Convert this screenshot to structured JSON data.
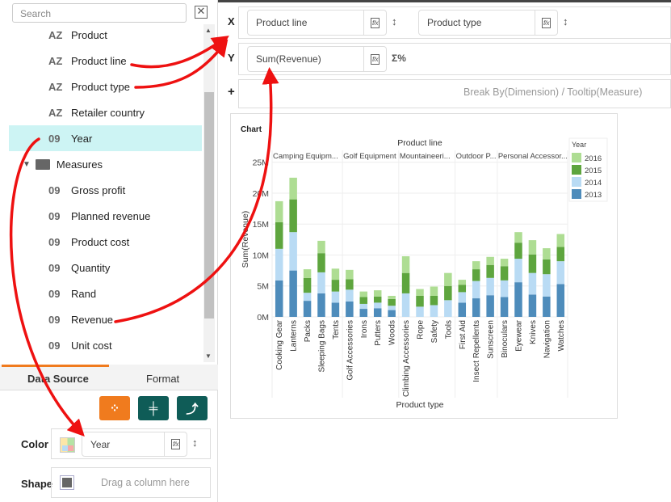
{
  "sidebar": {
    "search_placeholder": "Search",
    "dimensions": [
      {
        "type": "AZ",
        "label": "Product"
      },
      {
        "type": "AZ",
        "label": "Product line"
      },
      {
        "type": "AZ",
        "label": "Product type"
      },
      {
        "type": "AZ",
        "label": "Retailer country"
      },
      {
        "type": "09",
        "label": "Year",
        "selected": true
      }
    ],
    "measures_folder": "Measures",
    "measures": [
      {
        "type": "09",
        "label": "Gross profit"
      },
      {
        "type": "09",
        "label": "Planned revenue"
      },
      {
        "type": "09",
        "label": "Product cost"
      },
      {
        "type": "09",
        "label": "Quantity"
      },
      {
        "type": "09",
        "label": "Rand"
      },
      {
        "type": "09",
        "label": "Revenue"
      },
      {
        "type": "09",
        "label": "Unit cost"
      }
    ],
    "tabs": [
      "Data Source",
      "Format"
    ],
    "color_label": "Color",
    "color_value": "Year",
    "shape_label": "Shape",
    "shape_placeholder": "Drag a column here"
  },
  "shelves": {
    "x_label": "X",
    "x_fields": [
      "Product line",
      "Product type"
    ],
    "y_label": "Y",
    "y_field": "Sum(Revenue)",
    "y_icon": "Σ%",
    "plus_label": "+",
    "break_placeholder": "Break By(Dimension) / Tooltip(Measure)",
    "fx": "f/x"
  },
  "colors": {
    "accent": "#f07b1e",
    "teal": "#0f5c57",
    "arrow": "#ee1111"
  },
  "chart_data": {
    "type": "bar",
    "stacked": true,
    "title": "Chart",
    "facet_title": "Product line",
    "facets": [
      {
        "label": "Camping Equipm...",
        "count": 5
      },
      {
        "label": "Golf Equipment",
        "count": 4
      },
      {
        "label": "Mountaineeri...",
        "count": 4
      },
      {
        "label": "Outdoor P...",
        "count": 3
      },
      {
        "label": "Personal Accessor...",
        "count": 5
      }
    ],
    "xlabel": "Product type",
    "ylabel": "Sum(Revenue)",
    "ylim": [
      0,
      25000000
    ],
    "yticks": [
      "0M",
      "5M",
      "10M",
      "15M",
      "20M",
      "25M"
    ],
    "grid": true,
    "legend_placement": "right",
    "legend_title": "Year",
    "categories": [
      "Cooking Gear",
      "Lanterns",
      "Packs",
      "Sleeping Bags",
      "Tents",
      "Golf Accessories",
      "Irons",
      "Putters",
      "Woods",
      "Climbing Accessories",
      "Rope",
      "Safety",
      "Tools",
      "First Aid",
      "Insect Repellents",
      "Sunscreen",
      "Binoculars",
      "Eyewear",
      "Knives",
      "Navigation",
      "Watches"
    ],
    "series": [
      {
        "name": "2013",
        "color": "#4e8cbb",
        "values": [
          5.9,
          7.5,
          2.6,
          3.8,
          2.3,
          2.5,
          1.3,
          1.4,
          1.1,
          0,
          0,
          0,
          0,
          2.3,
          3.0,
          3.5,
          3.2,
          5.6,
          3.6,
          3.3,
          5.3
        ]
      },
      {
        "name": "2014",
        "color": "#b9dbf4",
        "values": [
          5.1,
          6.2,
          1.3,
          3.4,
          1.8,
          1.9,
          0.8,
          0.9,
          0.7,
          3.8,
          1.65,
          1.9,
          2.7,
          1.7,
          2.8,
          2.8,
          2.7,
          3.8,
          3.5,
          3.6,
          3.7
        ]
      },
      {
        "name": "2015",
        "color": "#5ea53e",
        "values": [
          4.3,
          5.3,
          2.4,
          3.1,
          1.9,
          1.7,
          1.1,
          1.0,
          1.1,
          3.3,
          1.75,
          1.5,
          2.3,
          1.2,
          1.9,
          2.1,
          2.3,
          2.6,
          3.0,
          2.4,
          2.3
        ]
      },
      {
        "name": "2016",
        "color": "#aedd93",
        "values": [
          3.4,
          3.5,
          1.4,
          2.0,
          1.8,
          1.5,
          0.9,
          1.0,
          0.5,
          2.7,
          1.1,
          1.5,
          2.1,
          0.8,
          1.3,
          1.3,
          1.2,
          1.7,
          2.3,
          1.8,
          2.1
        ]
      }
    ],
    "value_unit": "M"
  }
}
